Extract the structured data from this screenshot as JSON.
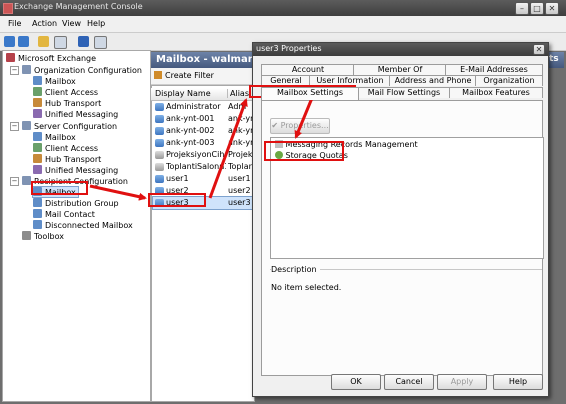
{
  "window": {
    "title": "Exchange Management Console",
    "min": "–",
    "max": "□",
    "close": "✕"
  },
  "menu": [
    "File",
    "Action",
    "View",
    "Help"
  ],
  "tree": {
    "root": "Microsoft Exchange",
    "org_config": "Organization Configuration",
    "org_items": [
      "Mailbox",
      "Client Access",
      "Hub Transport",
      "Unified Messaging"
    ],
    "server_config": "Server Configuration",
    "server_items": [
      "Mailbox",
      "Client Access",
      "Hub Transport",
      "Unified Messaging"
    ],
    "recipient_config": "Recipient Configuration",
    "recipient_items": [
      "Mailbox",
      "Distribution Group",
      "Mail Contact",
      "Disconnected Mailbox"
    ],
    "toolbox": "Toolbox"
  },
  "middle": {
    "header": "Mailbox - walmar",
    "filter": "Create Filter",
    "col_display": "Display Name",
    "col_alias": "Alias",
    "rows": [
      {
        "name": "Administrator",
        "alias": "Adm"
      },
      {
        "name": "ank-ynt-001",
        "alias": "ank-yn"
      },
      {
        "name": "ank-ynt-002",
        "alias": "ank-yn"
      },
      {
        "name": "ank-ynt-003",
        "alias": "ank-yn"
      },
      {
        "name": "ProjeksiyonCihazi",
        "alias": "Projeks"
      },
      {
        "name": "ToplantiSalonu1",
        "alias": "Toplan"
      },
      {
        "name": "user1",
        "alias": "user1"
      },
      {
        "name": "user2",
        "alias": "user2"
      },
      {
        "name": "user3",
        "alias": "user3"
      }
    ]
  },
  "dialog": {
    "title": "user3 Properties",
    "close": "✕",
    "tabs_row1": [
      "Account",
      "Member Of",
      "E-Mail Addresses"
    ],
    "tabs_row2": [
      "General",
      "User Information",
      "Address and Phone",
      "Organization"
    ],
    "tabs_row3": [
      "Mailbox Settings",
      "Mail Flow Settings",
      "Mailbox Features"
    ],
    "properties_btn": "Properties...",
    "settings": [
      "Messaging Records Management",
      "Storage Quotas"
    ],
    "description_label": "Description",
    "description_text": "No item selected.",
    "buttons": {
      "ok": "OK",
      "cancel": "Cancel",
      "apply": "Apply",
      "help": "Help"
    }
  },
  "right_strip_label": "ts",
  "colors": {
    "accent": "#e01010",
    "header": "#45597e"
  }
}
